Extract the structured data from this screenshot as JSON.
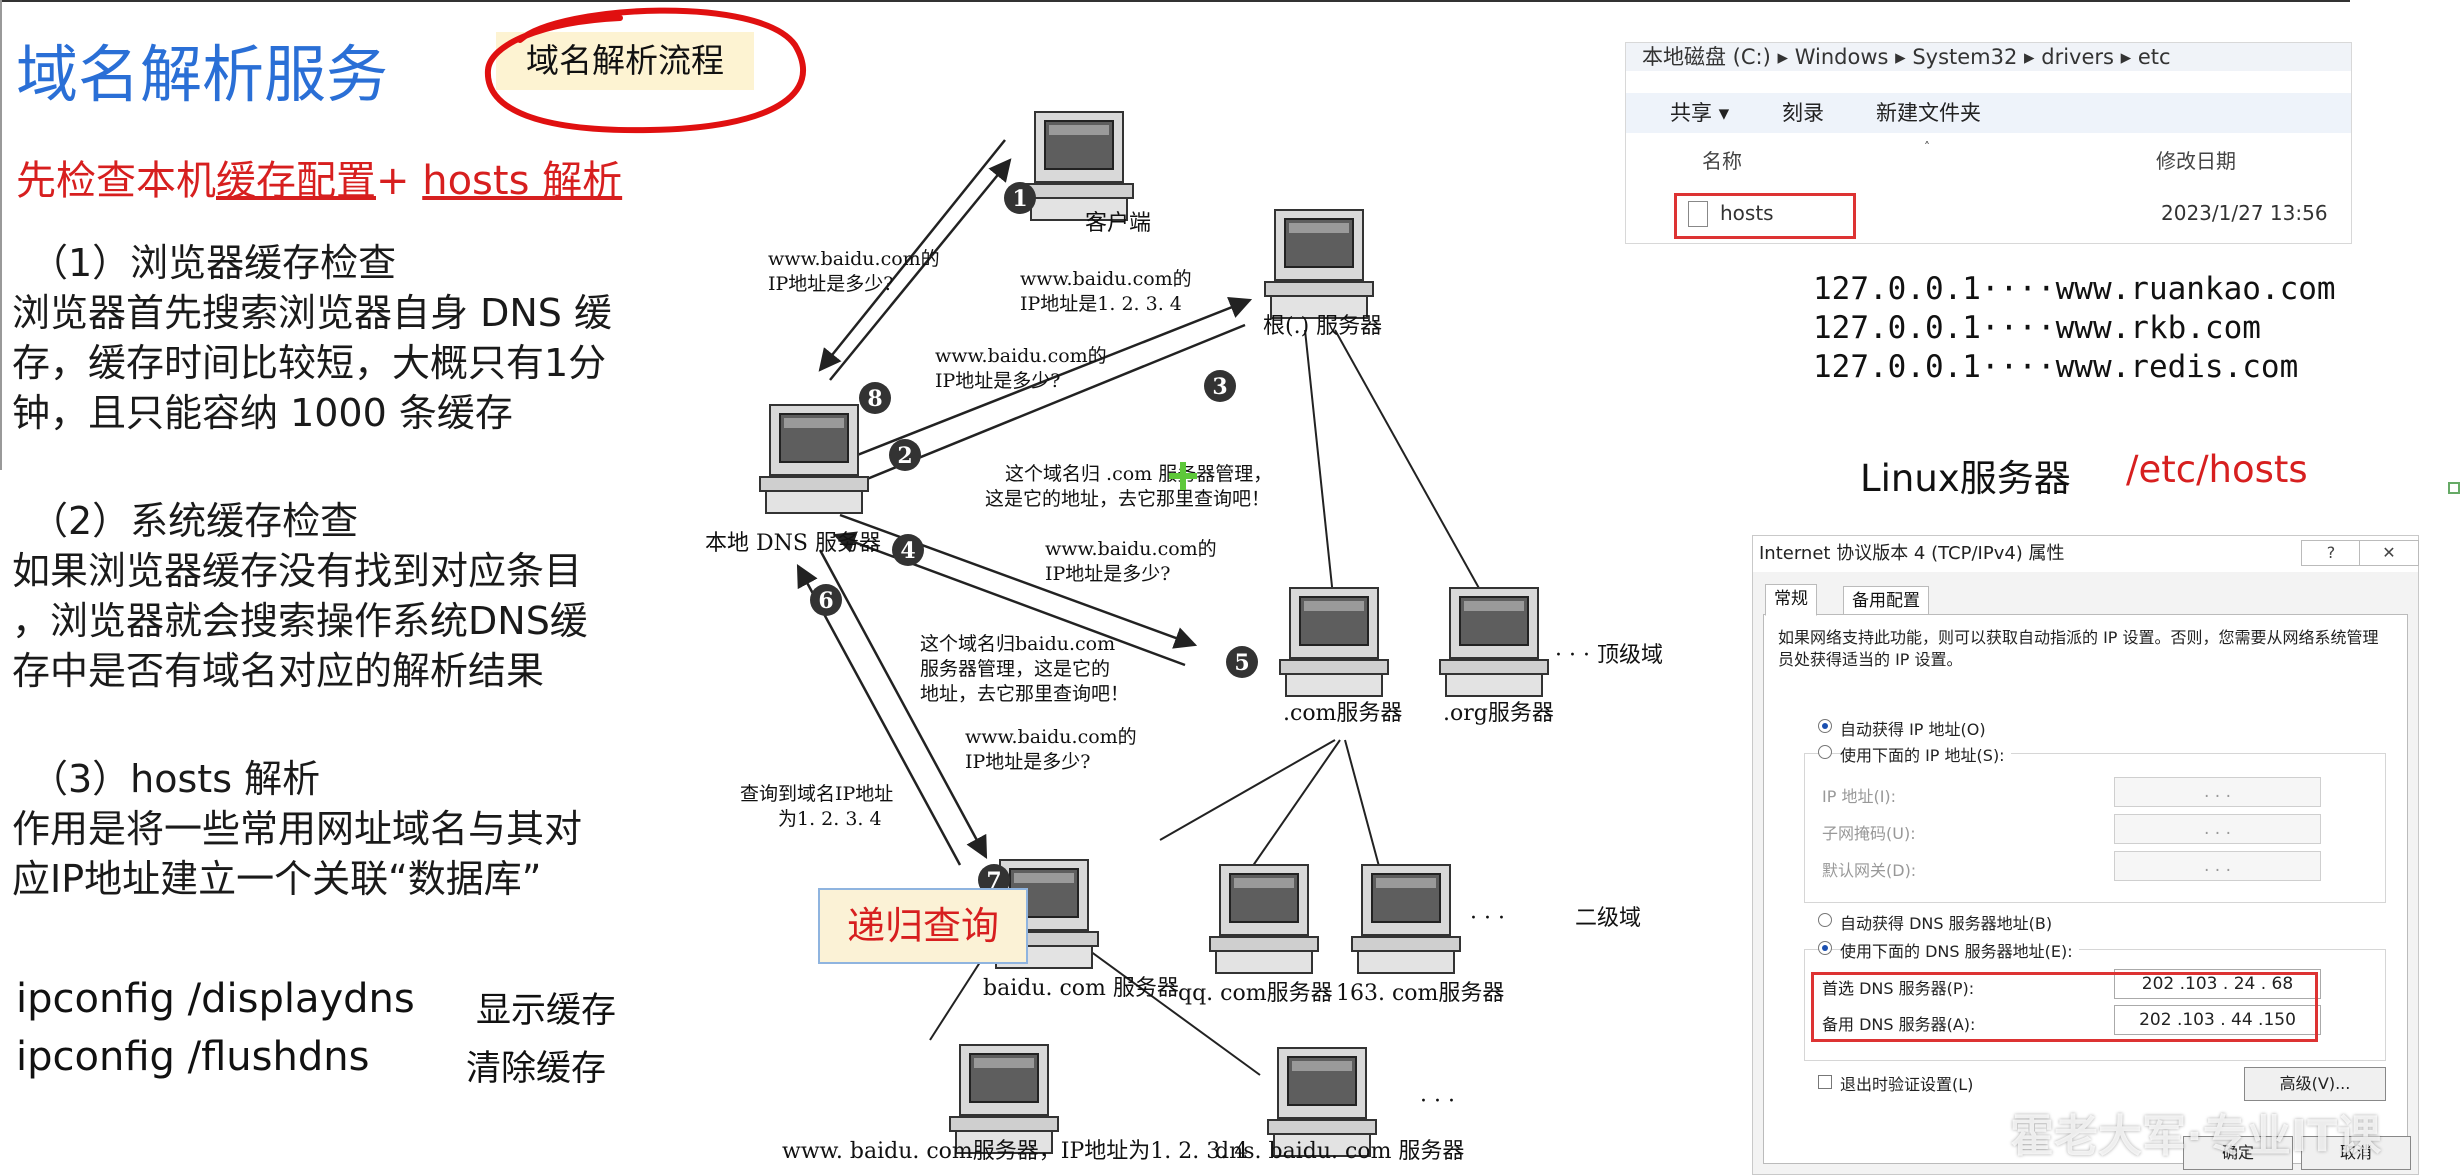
{
  "slide": {
    "title": "域名解析服务",
    "flow_button": "域名解析流程",
    "subtitle_part1": "先检查本机",
    "subtitle_part2": "缓存配置",
    "subtitle_part3": "+ ",
    "subtitle_part4": "hosts 解析"
  },
  "sections": [
    {
      "heading": "（1）浏览器缓存检查",
      "lines": [
        "浏览器首先搜索浏览器自身 DNS 缓",
        "存，缓存时间比较短，大概只有1分",
        "钟，且只能容纳 1000 条缓存"
      ]
    },
    {
      "heading": "（2）系统缓存检查",
      "lines": [
        "如果浏览器缓存没有找到对应条目",
        "，浏览器就会搜索操作系统DNS缓",
        "存中是否有域名对应的解析结果"
      ]
    },
    {
      "heading": "（3）hosts 解析",
      "lines": [
        "作用是将一些常用网址域名与其对",
        "应IP地址建立一个关联“数据库”"
      ]
    }
  ],
  "commands": [
    {
      "cmd": "ipconfig /displaydns",
      "note": "显示缓存"
    },
    {
      "cmd": "ipconfig /flushdns",
      "note": "清除缓存"
    }
  ],
  "diagram": {
    "client": "客户端",
    "root_server": "根(.) 服务器",
    "local_dns": "本地 DNS 服务器",
    "com_server": ".com服务器",
    "org_server": ".org服务器",
    "tld_label": "· · · 顶级域",
    "baidu_server": "baidu. com 服务器",
    "qq_server": "qq. com服务器",
    "s163_server": "163. com服务器",
    "sld_label": "二级域",
    "dots": "· · ·",
    "www_server": "www. baidu. com服务器，IP地址为1. 2. 3. 4",
    "dns_baidu_server": "dns. baidu. com 服务器",
    "msg_q1_a": "www.baidu.com的",
    "msg_q1_b": "IP地址是多少?",
    "msg_ans_a": "www.baidu.com的",
    "msg_ans_b": "IP地址是1. 2. 3. 4",
    "msg_q3_a": "www.baidu.com的",
    "msg_q3_b": "IP地址是多少?",
    "msg_ref1_a": "这个域名归 .com 服务器管理，",
    "msg_ref1_b": "这是它的地址，去它那里查询吧！",
    "msg_q4_a": "www.baidu.com的",
    "msg_q4_b": "IP地址是多少?",
    "msg_ref2_a": "这个域名归baidu.com",
    "msg_ref2_b": "服务器管理，这是它的",
    "msg_ref2_c": "地址，去它那里查询吧！",
    "msg_q6_a": "www.baidu.com的",
    "msg_q6_b": "IP地址是多少?",
    "msg_found_a": "查询到域名IP地址",
    "msg_found_b": "为1. 2. 3. 4",
    "steps": [
      "1",
      "2",
      "3",
      "4",
      "5",
      "6",
      "7",
      "8"
    ],
    "recursive_label": "递归查询"
  },
  "explorer": {
    "breadcrumb": "本地磁盘 (C:) ▸ Windows ▸ System32 ▸ drivers ▸ etc",
    "toolbar": [
      "共享 ▾",
      "刻录",
      "新建文件夹"
    ],
    "col_name": "名称",
    "col_date": "修改日期",
    "file_name": "hosts",
    "file_date": "2023/1/27 13:56"
  },
  "hosts_entries": [
    "127.0.0.1····www.ruankao.com",
    "127.0.0.1····www.rkb.com",
    "127.0.0.1····www.redis.com"
  ],
  "linux": {
    "label": "Linux服务器",
    "path": "/etc/hosts"
  },
  "dialog": {
    "title": "Internet 协议版本 4 (TCP/IPv4) 属性",
    "help": "?",
    "close": "✕",
    "tab_general": "常规",
    "tab_alt": "备用配置",
    "desc": "如果网络支持此功能，则可以获取自动指派的 IP 设置。否则，您需要从网络系统管理员处获得适当的 IP 设置。",
    "auto_ip": "自动获得 IP 地址(O)",
    "manual_ip": "使用下面的 IP 地址(S):",
    "ip_addr": "IP 地址(I):",
    "subnet": "子网掩码(U):",
    "gateway": "默认网关(D):",
    "empty_ip": ".   .   .",
    "auto_dns": "自动获得 DNS 服务器地址(B)",
    "manual_dns": "使用下面的 DNS 服务器地址(E):",
    "pref_dns": "首选 DNS 服务器(P):",
    "alt_dns": "备用 DNS 服务器(A):",
    "pref_dns_value": "202 .103 . 24 . 68",
    "alt_dns_value": "202 .103 . 44 .150",
    "validate": "退出时验证设置(L)",
    "advanced": "高级(V)...",
    "ok": "确定",
    "cancel": "取消"
  },
  "watermark": "霍老大军·专业IT课"
}
